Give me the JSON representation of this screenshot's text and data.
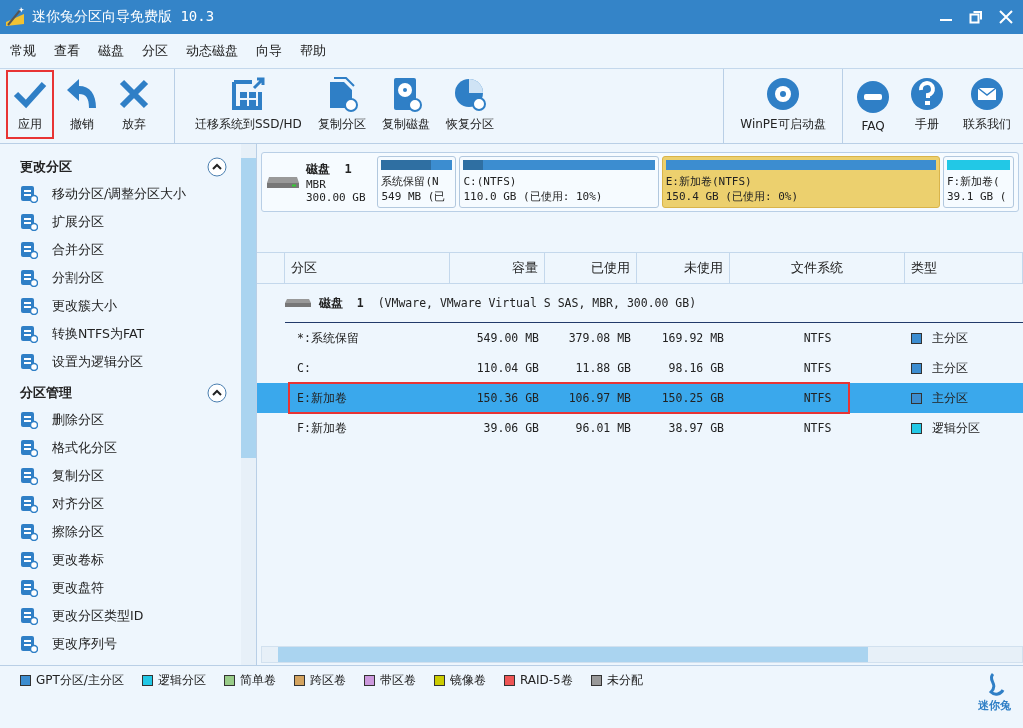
{
  "window": {
    "title": "迷你兔分区向导免费版 10.3"
  },
  "menu": [
    "常规",
    "查看",
    "磁盘",
    "分区",
    "动态磁盘",
    "向导",
    "帮助"
  ],
  "toolbar": {
    "groups": [
      [
        {
          "label": "应用",
          "highlighted": true
        },
        {
          "label": "撤销",
          "highlighted": false
        },
        {
          "label": "放弃",
          "highlighted": false
        }
      ],
      [
        {
          "label": "迁移系统到SSD/HD",
          "highlighted": false
        },
        {
          "label": "复制分区",
          "highlighted": false
        },
        {
          "label": "复制磁盘",
          "highlighted": false
        },
        {
          "label": "恢复分区",
          "highlighted": false
        }
      ],
      [
        {
          "label": "WinPE可启动盘",
          "highlighted": false
        }
      ],
      [
        {
          "label": "FAQ",
          "highlighted": false
        },
        {
          "label": "手册",
          "highlighted": false
        },
        {
          "label": "联系我们",
          "highlighted": false
        }
      ]
    ]
  },
  "sidebar": {
    "sections": [
      {
        "title": "更改分区",
        "expanded": true,
        "items": [
          "移动分区/调整分区大小",
          "扩展分区",
          "合并分区",
          "分割分区",
          "更改簇大小",
          "转换NTFS为FAT",
          "设置为逻辑分区"
        ]
      },
      {
        "title": "分区管理",
        "expanded": true,
        "items": [
          "删除分区",
          "格式化分区",
          "复制分区",
          "对齐分区",
          "擦除分区",
          "更改卷标",
          "更改盘符",
          "更改分区类型ID",
          "更改序列号"
        ]
      }
    ]
  },
  "disk_map": {
    "name": "磁盘",
    "number": "1",
    "scheme": "MBR",
    "size": "300.00 GB",
    "partitions": [
      {
        "label": "系统保留(N",
        "detail": "549 MB (已",
        "level": 0.7,
        "color": "#3c8dd0",
        "selected": false
      },
      {
        "label": "C:(NTFS)",
        "detail": "110.0 GB (已使用: 10%)",
        "level": 0.1,
        "color": "#3c8dd0",
        "selected": false
      },
      {
        "label": "E:新加卷(NTFS)",
        "detail": "150.4 GB (已使用: 0%)",
        "level": 0.0,
        "color": "#3c8dd0",
        "selected": true
      },
      {
        "label": "F:新加卷(",
        "detail": "39.1 GB (",
        "level": 0.0,
        "color": "#22c8e6",
        "selected": false
      }
    ]
  },
  "table": {
    "columns": [
      "分区",
      "容量",
      "已使用",
      "未使用",
      "文件系统",
      "类型"
    ],
    "disk_row": {
      "name": "磁盘",
      "number": "1",
      "info": "(VMware, VMware Virtual S SAS, MBR, 300.00 GB)"
    },
    "rows": [
      {
        "partition": "*:系统保留",
        "capacity": "549.00 MB",
        "used": "379.08 MB",
        "unused": "169.92 MB",
        "fs": "NTFS",
        "type": "主分区",
        "color": "#3c8dd0",
        "selected": false,
        "highlighted": false
      },
      {
        "partition": "C:",
        "capacity": "110.04 GB",
        "used": "11.88 GB",
        "unused": "98.16 GB",
        "fs": "NTFS",
        "type": "主分区",
        "color": "#3c8dd0",
        "selected": false,
        "highlighted": false
      },
      {
        "partition": "E:新加卷",
        "capacity": "150.36 GB",
        "used": "106.97 MB",
        "unused": "150.25 GB",
        "fs": "NTFS",
        "type": "主分区",
        "color": "#3c8dd0",
        "selected": true,
        "highlighted": true
      },
      {
        "partition": "F:新加卷",
        "capacity": "39.06 GB",
        "used": "96.01 MB",
        "unused": "38.97 GB",
        "fs": "NTFS",
        "type": "逻辑分区",
        "color": "#22c8e6",
        "selected": false,
        "highlighted": false
      }
    ]
  },
  "legend": [
    {
      "label": "GPT分区/主分区",
      "color": "#3c8dd0"
    },
    {
      "label": "逻辑分区",
      "color": "#22c8e6"
    },
    {
      "label": "简单卷",
      "color": "#99cc88"
    },
    {
      "label": "跨区卷",
      "color": "#d4a460"
    },
    {
      "label": "带区卷",
      "color": "#cc99dd"
    },
    {
      "label": "镜像卷",
      "color": "#cccc00"
    },
    {
      "label": "RAID-5卷",
      "color": "#ee5555"
    },
    {
      "label": "未分配",
      "color": "#999999"
    }
  ],
  "brand": "迷你兔"
}
